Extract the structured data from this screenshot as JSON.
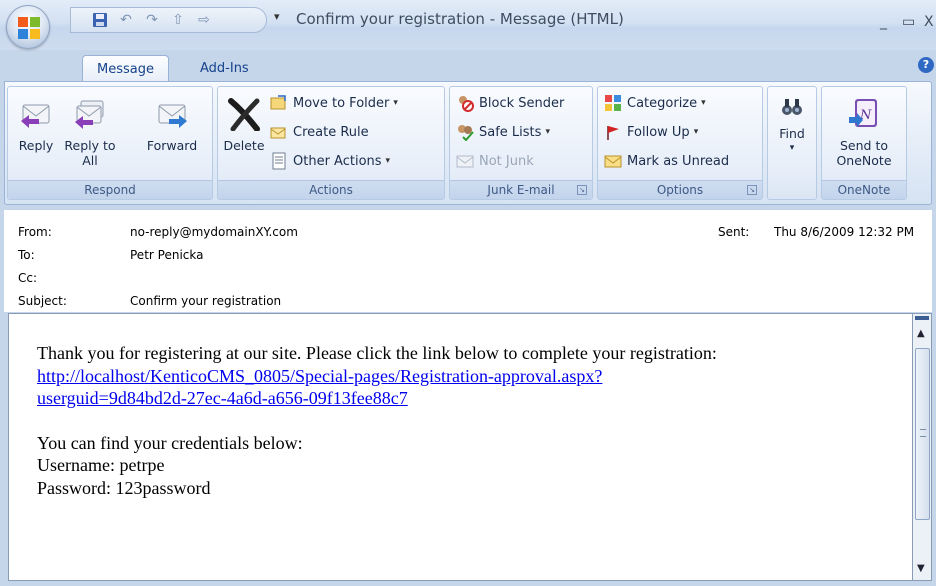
{
  "window": {
    "title": "Confirm your registration - Message (HTML)",
    "minimize_label": "_",
    "maximize_label": "▭",
    "close_label": "X"
  },
  "quick_access": {
    "save_icon": "save-icon",
    "undo_icon": "undo-icon",
    "redo_icon": "redo-icon",
    "up_icon": "up-arrow-icon",
    "down_icon": "down-arrow-icon",
    "more_label": "▾"
  },
  "tabs": [
    {
      "label": "Message",
      "active": true
    },
    {
      "label": "Add-Ins",
      "active": false
    }
  ],
  "help_label": "?",
  "ribbon": {
    "respond": {
      "label": "Respond",
      "reply": "Reply",
      "reply_all": "Reply to All",
      "forward": "Forward"
    },
    "actions": {
      "label": "Actions",
      "delete": "Delete",
      "move_to_folder": "Move to Folder",
      "create_rule": "Create Rule",
      "other_actions": "Other Actions"
    },
    "junk": {
      "label": "Junk E-mail",
      "block_sender": "Block Sender",
      "safe_lists": "Safe Lists",
      "not_junk": "Not Junk"
    },
    "options": {
      "label": "Options",
      "categorize": "Categorize",
      "follow_up": "Follow Up",
      "mark_unread": "Mark as Unread"
    },
    "find": {
      "label": "Find"
    },
    "onenote": {
      "label": "OneNote",
      "send_to": "Send to OneNote"
    }
  },
  "header": {
    "from_label": "From:",
    "from_value": "no-reply@mydomainXY.com",
    "to_label": "To:",
    "to_value": "Petr Penicka",
    "cc_label": "Cc:",
    "cc_value": "",
    "subject_label": "Subject:",
    "subject_value": "Confirm your registration",
    "sent_label": "Sent:",
    "sent_value": "Thu 8/6/2009 12:32 PM"
  },
  "body": {
    "line1": "Thank you for registering at our site. Please click the link below to complete your registration:",
    "link_line1": "http://localhost/KenticoCMS_0805/Special-pages/Registration-approval.aspx?",
    "link_line2": "userguid=9d84bd2d-27ec-4a6d-a656-09f13fee88c7",
    "line2": "You can find your credentials below:",
    "username": "Username: petrpe",
    "password": "Password: 123password"
  },
  "colors": {
    "ribbon_text": "#15428b",
    "link": "#0000ee",
    "frame": "#c5d5ea"
  }
}
